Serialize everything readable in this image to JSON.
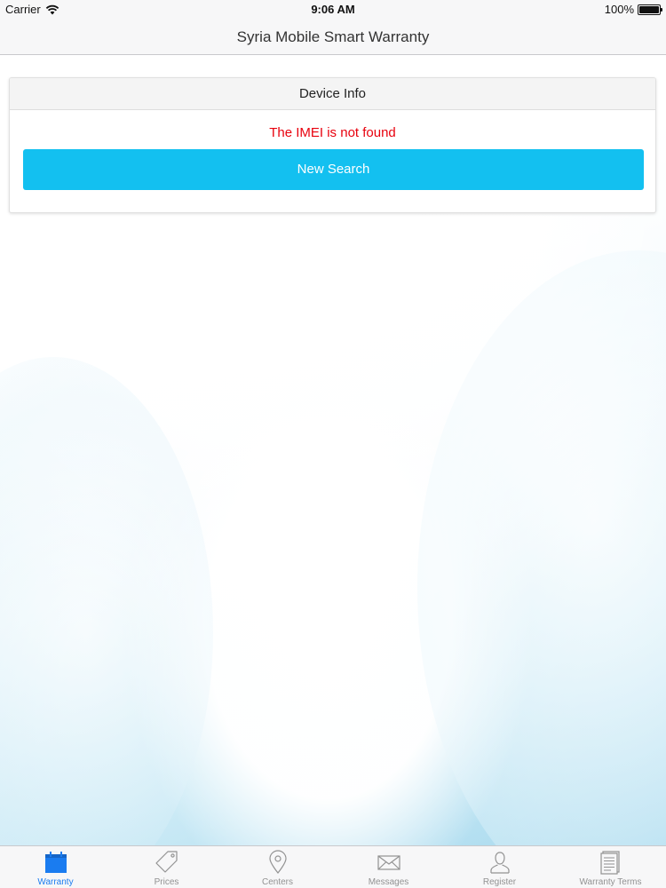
{
  "status_bar": {
    "carrier": "Carrier",
    "time": "9:06 AM",
    "battery": "100%"
  },
  "nav": {
    "title": "Syria Mobile Smart Warranty"
  },
  "card": {
    "title": "Device Info",
    "error": "The IMEI is not found",
    "button_label": "New Search"
  },
  "tabs": [
    {
      "label": "Warranty",
      "icon": "calendar-icon",
      "active": true
    },
    {
      "label": "Prices",
      "icon": "tag-icon",
      "active": false
    },
    {
      "label": "Centers",
      "icon": "map-pin-icon",
      "active": false
    },
    {
      "label": "Messages",
      "icon": "envelope-icon",
      "active": false
    },
    {
      "label": "Register",
      "icon": "person-icon",
      "active": false
    },
    {
      "label": "Warranty Terms",
      "icon": "document-icon",
      "active": false
    }
  ],
  "colors": {
    "accent": "#13c0f0",
    "error": "#e8000d",
    "tab_active": "#1a7cf0",
    "tab_inactive": "#929292"
  }
}
